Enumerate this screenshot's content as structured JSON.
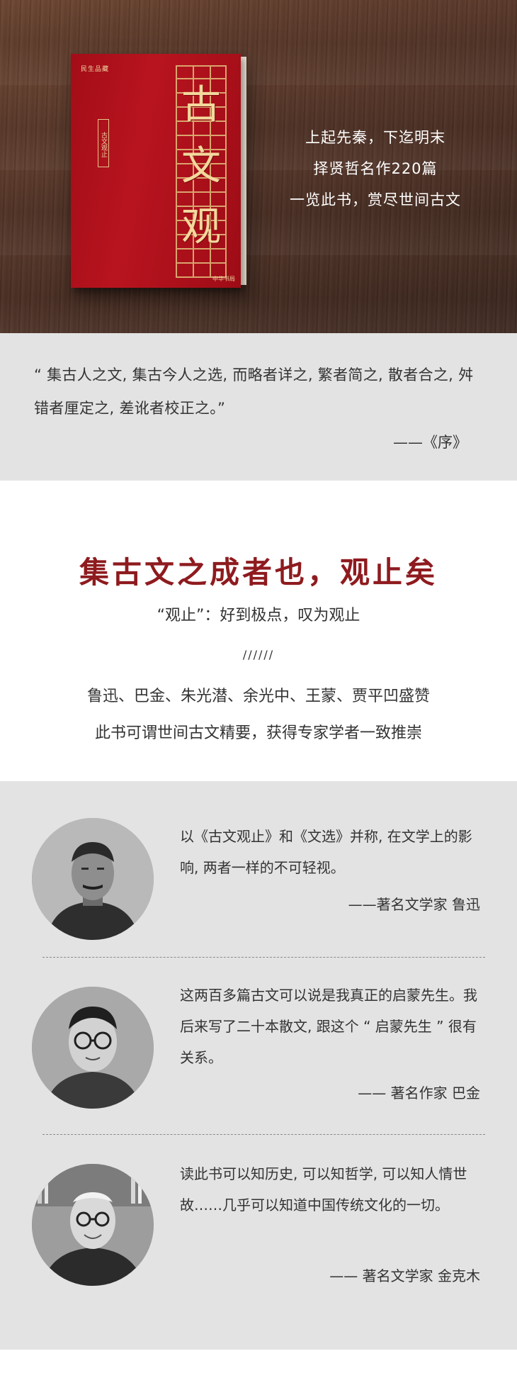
{
  "hero": {
    "book": {
      "publisher": "民生品藏",
      "spine_title": "古文观止",
      "calligraphy": [
        "古",
        "文",
        "观"
      ],
      "foot_text": "中华书局"
    },
    "lines": [
      "上起先秦，下迄明末",
      "择贤哲名作220篇",
      "一览此书，赏尽世间古文"
    ]
  },
  "preface_quote": {
    "text": "“ 集古人之文, 集古今人之选, 而略者详之, 繁者简之, 散者合之, 舛错者厘定之, 差讹者校正之。”",
    "source": "——《序》"
  },
  "intro": {
    "title": "集古文之成者也，观止矣",
    "subtitle": "“观止”：好到极点，叹为观止",
    "slashes": "//////",
    "line1": "鲁迅、巴金、朱光潜、余光中、王蒙、贾平凹盛赞",
    "line2": "此书可谓世间古文精要，获得专家学者一致推崇"
  },
  "testimonials": [
    {
      "avatar_icon": "portrait-luxun-icon",
      "quote": "以《古文观止》和《文选》并称, 在文学上的影响, 两者一样的不可轻视。",
      "author": "——著名文学家  鲁迅"
    },
    {
      "avatar_icon": "portrait-bajin-icon",
      "quote": "这两百多篇古文可以说是我真正的启蒙先生。我后来写了二十本散文, 跟这个 “ 启蒙先生 ” 很有关系。",
      "author": "—— 著名作家   巴金"
    },
    {
      "avatar_icon": "portrait-jinkemu-icon",
      "quote": "读此书可以知历史, 可以知哲学, 可以知人情世故……几乎可以知道中国传统文化的一切。",
      "author": "—— 著名文学家   金克木"
    }
  ],
  "colors": {
    "accent_red": "#8e1b1f",
    "band_gray": "#e3e3e3",
    "book_red": "#b8141f",
    "gold": "#e2be7d"
  }
}
